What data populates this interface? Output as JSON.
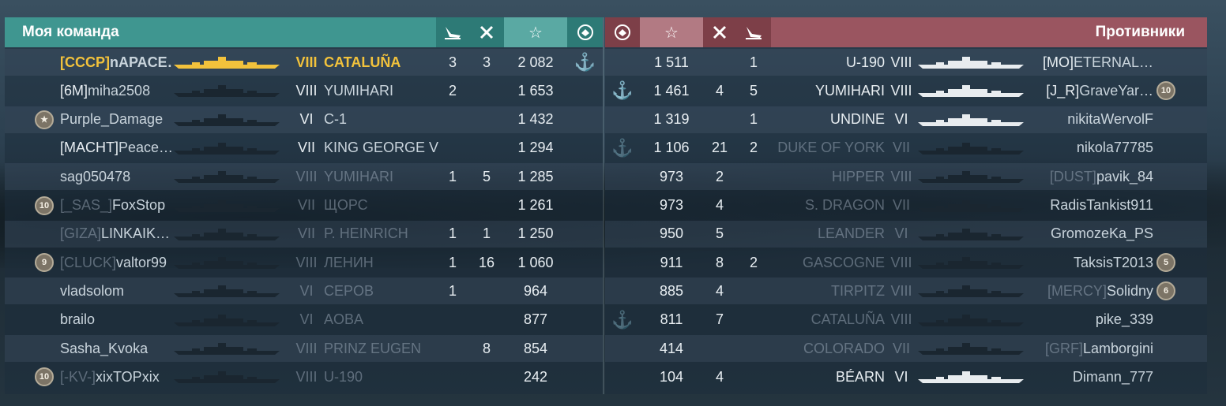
{
  "left": {
    "title": "Моя команда",
    "header_icons": [
      "planes-shot-icon",
      "kills-icon",
      "star-icon",
      "base-icon"
    ],
    "rows": [
      {
        "badge": "",
        "clan": "[CCCP]",
        "player": "nAPACE…",
        "tier": "VIII",
        "ship": "CATALUÑA",
        "planes": "3",
        "kills": "3",
        "xp": "2 082",
        "anchor": "⚓",
        "self": true,
        "dead": false
      },
      {
        "badge": "",
        "clan": "[6M]",
        "player": "miha2508",
        "tier": "VIII",
        "ship": "YUMIHARI",
        "planes": "2",
        "kills": "",
        "xp": "1 653",
        "anchor": "",
        "self": false,
        "dead": false
      },
      {
        "badge": "★",
        "clan": "",
        "player": "Purple_Damage",
        "tier": "VI",
        "ship": "C-1",
        "planes": "",
        "kills": "",
        "xp": "1 432",
        "anchor": "",
        "self": false,
        "dead": false
      },
      {
        "badge": "",
        "clan": "[MACHT]",
        "player": "Peace…",
        "tier": "VII",
        "ship": "KING GEORGE V",
        "planes": "",
        "kills": "",
        "xp": "1 294",
        "anchor": "",
        "self": false,
        "dead": false
      },
      {
        "badge": "",
        "clan": "",
        "player": "sag050478",
        "tier": "VIII",
        "ship": "YUMIHARI",
        "planes": "1",
        "kills": "5",
        "xp": "1 285",
        "anchor": "",
        "self": false,
        "dead": true
      },
      {
        "badge": "10",
        "clan": "[_SAS_]",
        "player": "FoxStop",
        "tier": "VII",
        "ship": "ЩОРС",
        "planes": "",
        "kills": "",
        "xp": "1 261",
        "anchor": "",
        "self": false,
        "dead": true
      },
      {
        "badge": "",
        "clan": "[GIZA]",
        "player": "LINKAIK…",
        "tier": "VII",
        "ship": "P. HEINRICH",
        "planes": "1",
        "kills": "1",
        "xp": "1 250",
        "anchor": "",
        "self": false,
        "dead": true
      },
      {
        "badge": "9",
        "clan": "[CLUCK]",
        "player": "valtor99",
        "tier": "VIII",
        "ship": "ЛЕНИН",
        "planes": "1",
        "kills": "16",
        "xp": "1 060",
        "anchor": "",
        "self": false,
        "dead": true
      },
      {
        "badge": "",
        "clan": "",
        "player": "vladsolom",
        "tier": "VI",
        "ship": "CEPOB",
        "planes": "1",
        "kills": "",
        "xp": "964",
        "anchor": "",
        "self": false,
        "dead": true
      },
      {
        "badge": "",
        "clan": "",
        "player": "brailo",
        "tier": "VI",
        "ship": "AOBA",
        "planes": "",
        "kills": "",
        "xp": "877",
        "anchor": "",
        "self": false,
        "dead": true
      },
      {
        "badge": "",
        "clan": "",
        "player": "Sasha_Kvoka",
        "tier": "VIII",
        "ship": "PRINZ EUGEN",
        "planes": "",
        "kills": "8",
        "xp": "854",
        "anchor": "",
        "self": false,
        "dead": true
      },
      {
        "badge": "10",
        "clan": "[-KV-]",
        "player": "xixTOPxix",
        "tier": "VIII",
        "ship": "U-190",
        "planes": "",
        "kills": "",
        "xp": "242",
        "anchor": "",
        "self": false,
        "dead": true
      }
    ]
  },
  "right": {
    "title": "Противники",
    "header_icons": [
      "base-icon",
      "star-icon",
      "kills-icon",
      "planes-shot-icon"
    ],
    "rows": [
      {
        "anchor": "",
        "xp": "1 511",
        "kills": "",
        "planes": "1",
        "ship": "U-190",
        "tier": "VIII",
        "clan": "[MO]",
        "player": "ETERNAL…",
        "badge": "",
        "dead": false
      },
      {
        "anchor": "⚓",
        "xp": "1 461",
        "kills": "4",
        "planes": "5",
        "ship": "YUMIHARI",
        "tier": "VIII",
        "clan": "[J_R]",
        "player": "GraveYar…",
        "badge": "10",
        "dead": false
      },
      {
        "anchor": "",
        "xp": "1 319",
        "kills": "",
        "planes": "1",
        "ship": "UNDINE",
        "tier": "VI",
        "clan": "",
        "player": "nikitaWervolF",
        "badge": "",
        "dead": false
      },
      {
        "anchor": "⚓",
        "xp": "1 106",
        "kills": "21",
        "planes": "2",
        "ship": "DUKE OF YORK",
        "tier": "VII",
        "clan": "",
        "player": "nikola77785",
        "badge": "",
        "dead": true
      },
      {
        "anchor": "",
        "xp": "973",
        "kills": "2",
        "planes": "",
        "ship": "HIPPER",
        "tier": "VIII",
        "clan": "[DUST]",
        "player": "pavik_84",
        "badge": "",
        "dead": true
      },
      {
        "anchor": "",
        "xp": "973",
        "kills": "4",
        "planes": "",
        "ship": "S. DRAGON",
        "tier": "VII",
        "clan": "",
        "player": "RadisTankist911",
        "badge": "",
        "dead": true
      },
      {
        "anchor": "",
        "xp": "950",
        "kills": "5",
        "planes": "",
        "ship": "LEANDER",
        "tier": "VI",
        "clan": "",
        "player": "GromozeKa_PS",
        "badge": "",
        "dead": true
      },
      {
        "anchor": "",
        "xp": "911",
        "kills": "8",
        "planes": "2",
        "ship": "GASCOGNE",
        "tier": "VIII",
        "clan": "",
        "player": "TaksisT2013",
        "badge": "5",
        "dead": true
      },
      {
        "anchor": "",
        "xp": "885",
        "kills": "4",
        "planes": "",
        "ship": "TIRPITZ",
        "tier": "VIII",
        "clan": "[MERCY]",
        "player": "Solidny",
        "badge": "6",
        "dead": true
      },
      {
        "anchor": "⚓",
        "xp": "811",
        "kills": "7",
        "planes": "",
        "ship": "CATALUÑA",
        "tier": "VIII",
        "clan": "",
        "player": "pike_339",
        "badge": "",
        "dead": true
      },
      {
        "anchor": "",
        "xp": "414",
        "kills": "",
        "planes": "",
        "ship": "COLORADO",
        "tier": "VII",
        "clan": "[GRF]",
        "player": "Lamborgini",
        "badge": "",
        "dead": true
      },
      {
        "anchor": "",
        "xp": "104",
        "kills": "4",
        "planes": "",
        "ship": "BÉARN",
        "tier": "VI",
        "clan": "",
        "player": "Dimann_777",
        "badge": "",
        "dead": false
      }
    ]
  },
  "colors": {
    "self": "#f2c23c",
    "ally_header": "#3f9690",
    "enemy_header": "#9a5560",
    "anchor": "#e8b830"
  }
}
